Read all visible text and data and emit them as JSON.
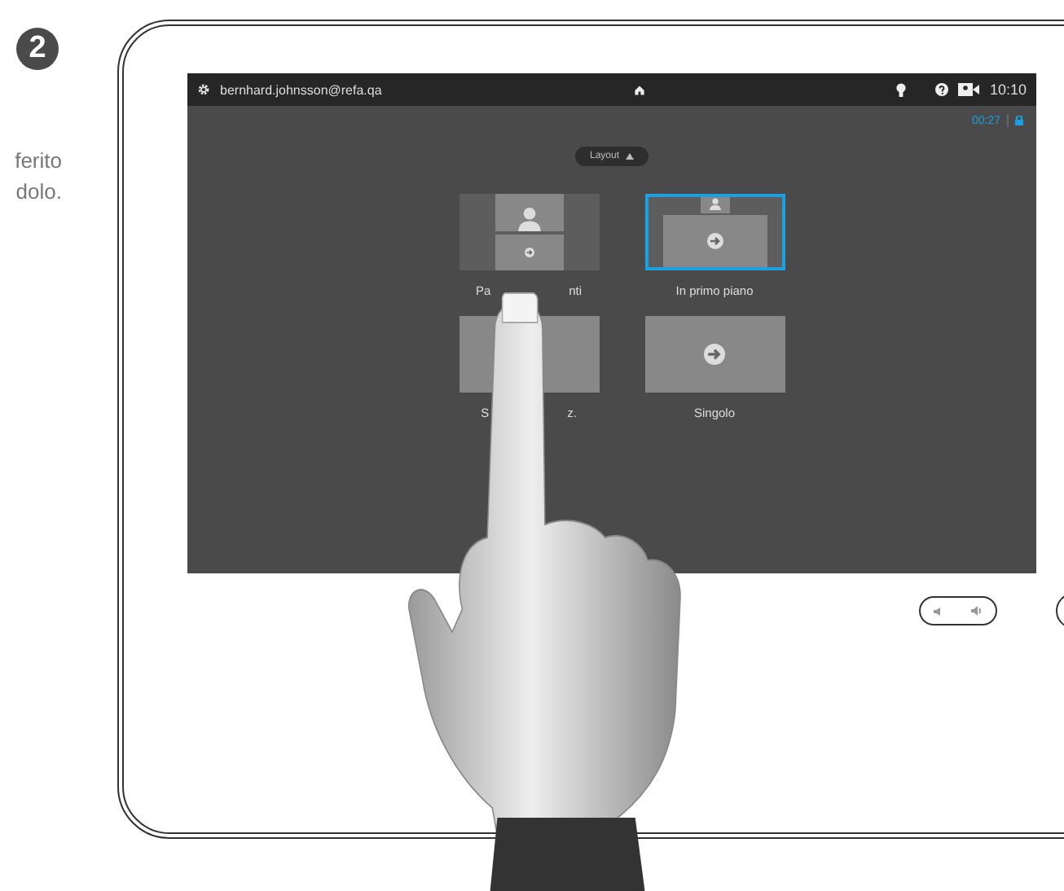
{
  "step": {
    "number": "2",
    "text_lines": [
      "ferito",
      "dolo."
    ]
  },
  "device": {
    "top_bar": {
      "user": "bernhard.johnsson@refa.qa",
      "time": "10:10"
    },
    "call": {
      "duration": "00:27"
    },
    "layout_menu": {
      "label": "Layout",
      "expanded": true
    },
    "layouts": [
      {
        "kind": "split",
        "label_parts": [
          "Pa",
          "nti"
        ],
        "selected": false
      },
      {
        "kind": "prominent",
        "label_parts": [
          "In primo piano"
        ],
        "selected": true
      },
      {
        "kind": "equal",
        "label_parts": [
          "S",
          "z."
        ],
        "selected": false
      },
      {
        "kind": "single",
        "label_parts": [
          "Singolo"
        ],
        "selected": false
      }
    ]
  }
}
